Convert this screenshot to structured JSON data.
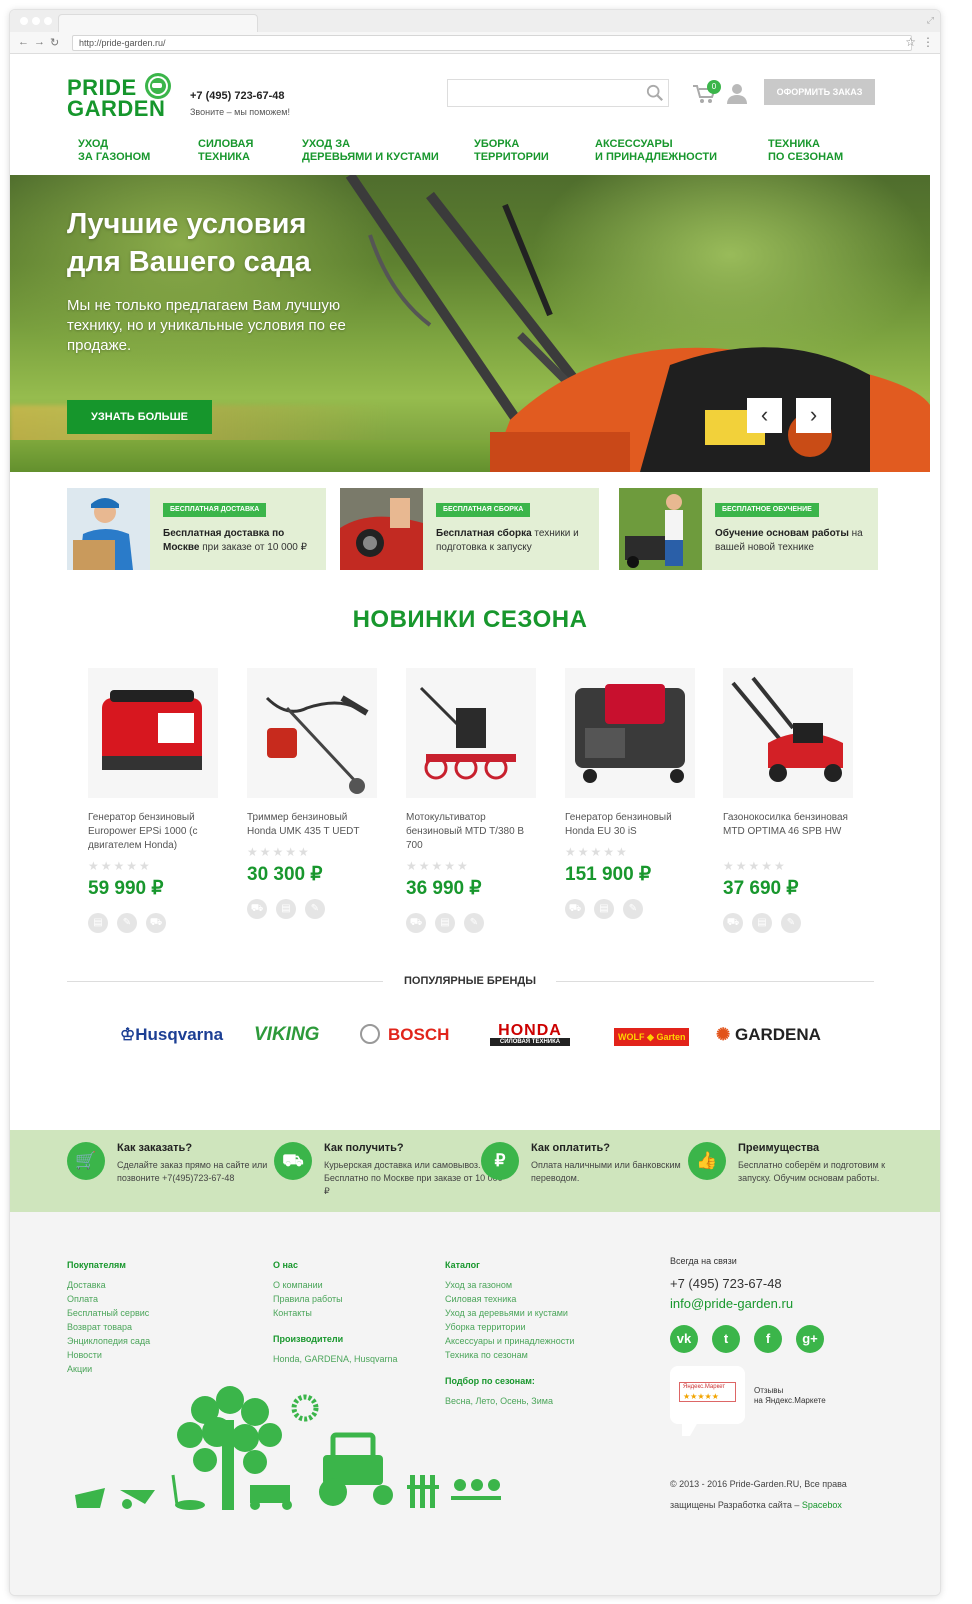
{
  "browser": {
    "url": "http://pride-garden.ru/"
  },
  "header": {
    "logo_line1": "PRIDE",
    "logo_line2": "GARDEN",
    "phone": "+7 (495) 723-67-48",
    "call_us": "Звоните – мы поможем!",
    "search_placeholder": "",
    "cart_count": "0",
    "order_button": "Оформить заказ"
  },
  "nav": [
    {
      "label": "Уход\nза газоном"
    },
    {
      "label": "Силовая\nтехника"
    },
    {
      "label": "Уход за\nдеревьями и кустами"
    },
    {
      "label": "Уборка\nтерритории"
    },
    {
      "label": "Аксессуары\nи принадлежности"
    },
    {
      "label": "Техника\nпо сезонам"
    }
  ],
  "hero": {
    "title": "Лучшие условия\nдля Вашего сада",
    "text": "Мы не только предлагаем Вам лучшую технику, но и уникальные условия по ее продаже.",
    "button": "Узнать больше",
    "prev": "‹",
    "next": "›"
  },
  "features": [
    {
      "badge": "Бесплатная доставка",
      "bold": "Бесплатная доставка по Москве",
      "rest": " при заказе от 10 000 ₽"
    },
    {
      "badge": "Бесплатная сборка",
      "bold": "Бесплатная сборка",
      "rest": " техники и подготовка к запуску"
    },
    {
      "badge": "Бесплатное обучение",
      "bold": "Обучение основам работы",
      "rest": " на вашей новой технике"
    }
  ],
  "new_title": "НОВИНКИ СЕЗОНА",
  "products": [
    {
      "name": "Генератор бензиновый Europower EPSi 1000 (с двигателем Honda)",
      "stars": "★★★★★",
      "price": "59 990 ₽",
      "rating": 0
    },
    {
      "name": "Триммер бензиновый Honda UMK 435 T UEDT",
      "stars": "★★★★★",
      "price": "30 300 ₽",
      "rating": 0
    },
    {
      "name": "Мотокультиватор бензиновый MTD T/380 B 700",
      "stars": "★★★★★",
      "price": "36 990 ₽",
      "rating": 0
    },
    {
      "name": "Генератор бензиновый Honda EU 30 iS",
      "stars": "★★★★★",
      "price": "151 900 ₽",
      "rating": 0
    },
    {
      "name": "Газонокосилка бензиновая MTD OPTIMA 46 SPB HW",
      "stars": "★★★★★",
      "price": "37 690 ₽",
      "rating": 0
    }
  ],
  "brands_title": "Популярные бренды",
  "brands": [
    {
      "name": "Husqvarna",
      "color": "#1c3f94"
    },
    {
      "name": "VIKING",
      "color": "#2d9a3a"
    },
    {
      "name": "BOSCH",
      "color": "#e1251b"
    },
    {
      "name": "HONDA",
      "sub": "СИЛОВАЯ ТЕХНИКА",
      "color": "#cc0000"
    },
    {
      "name": "WOLF",
      "sub": "Garten",
      "color": "#e2231a"
    },
    {
      "name": "GARDENA",
      "color": "#222222"
    }
  ],
  "info": [
    {
      "icon": "🛒",
      "title": "Как заказать?",
      "text": "Сделайте заказ прямо на сайте или позвоните +7(495)723-67-48"
    },
    {
      "icon": "⛟",
      "title": "Как получить?",
      "text": "Курьерская доставка или самовывоз. Бесплатно по Москве при заказе от 10 000 ₽"
    },
    {
      "icon": "₽",
      "title": "Как оплатить?",
      "text": "Оплата наличными или банковским переводом."
    },
    {
      "icon": "👍",
      "title": "Преимущества",
      "text": "Бесплатно соберём и подготовим к запуску. Обучим основам работы."
    }
  ],
  "footer": {
    "buyers_title": "Покупателям",
    "buyers": [
      "Доставка",
      "Оплата",
      "Бесплатный сервис",
      "Возврат товара",
      "Энциклопедия сада",
      "Новости",
      "Акции"
    ],
    "about_title": "О нас",
    "about": [
      "О компании",
      "Правила работы",
      "Контакты"
    ],
    "makers_title": "Производители",
    "makers": [
      "Honda, GARDENA, Husqvarna"
    ],
    "catalog_title": "Каталог",
    "catalog": [
      "Уход за газоном",
      "Силовая техника",
      "Уход за деревьями и кустами",
      "Уборка территории",
      "Аксессуары и принадлежности",
      "Техника по сезонам"
    ],
    "seasons_title": "Подбор по сезонам:",
    "seasons": [
      "Весна, Лето, Осень, Зима"
    ],
    "contact_title": "Всегда на связи",
    "contact_phone": "+7 (495) 723-67-48",
    "contact_email": "info@pride-garden.ru",
    "social": [
      "vk",
      "t",
      "f",
      "g+"
    ],
    "ym_badge": "Яндекс.Маркет",
    "ym_stars": "★★★★★",
    "ym_text": "Отзывы\nна Яндекс.Маркете",
    "copyright": "© 2013 - 2016 Pride-Garden.RU, Все права защищены Разработка сайта –",
    "dev": "Spacebox"
  },
  "colors": {
    "brand_green": "#18972d",
    "light_green": "#e3efd5",
    "strip_green": "#cfe5bd"
  }
}
